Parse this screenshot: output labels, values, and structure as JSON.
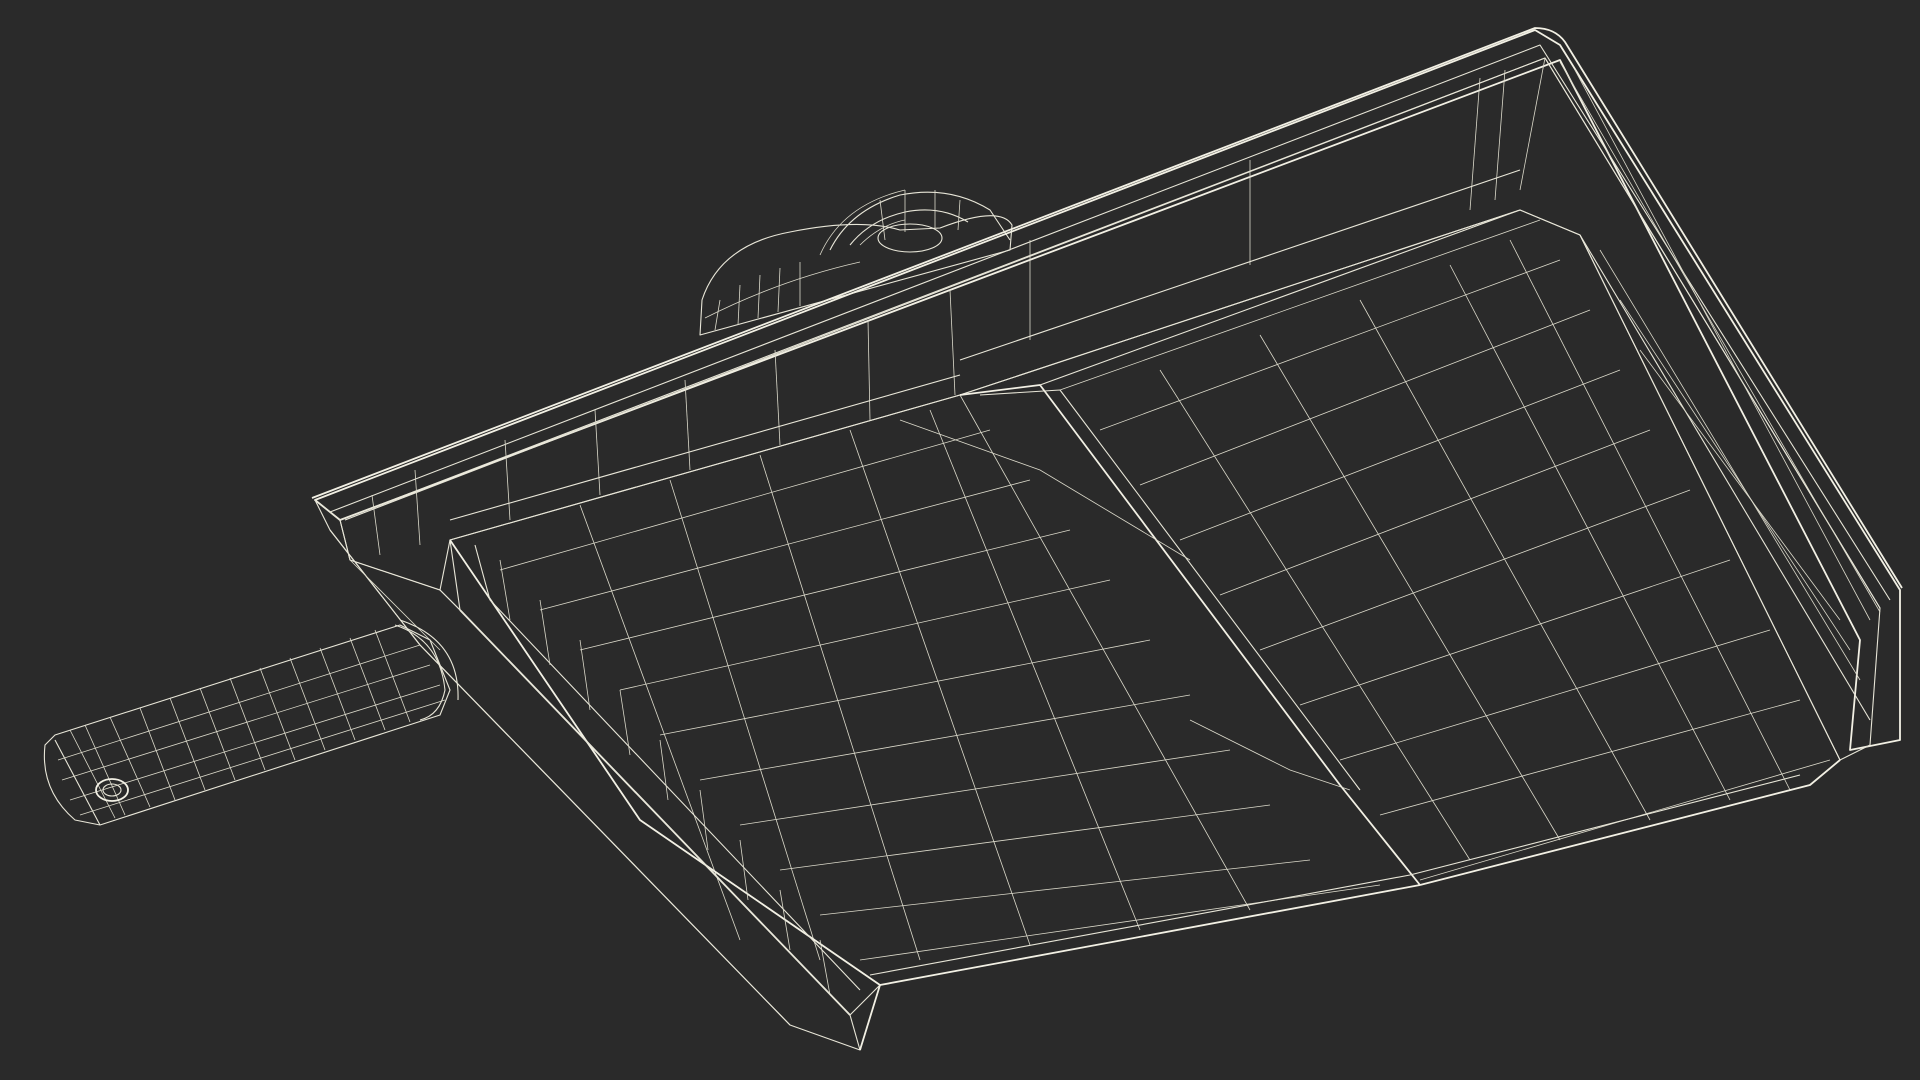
{
  "scene": {
    "background_color": "#2a2a2a",
    "shade_light": "#8a8a7e",
    "shade_mid": "#7a7a6e",
    "shade_dark": "#5c5c54",
    "wire_color": "#e8e6d8"
  }
}
